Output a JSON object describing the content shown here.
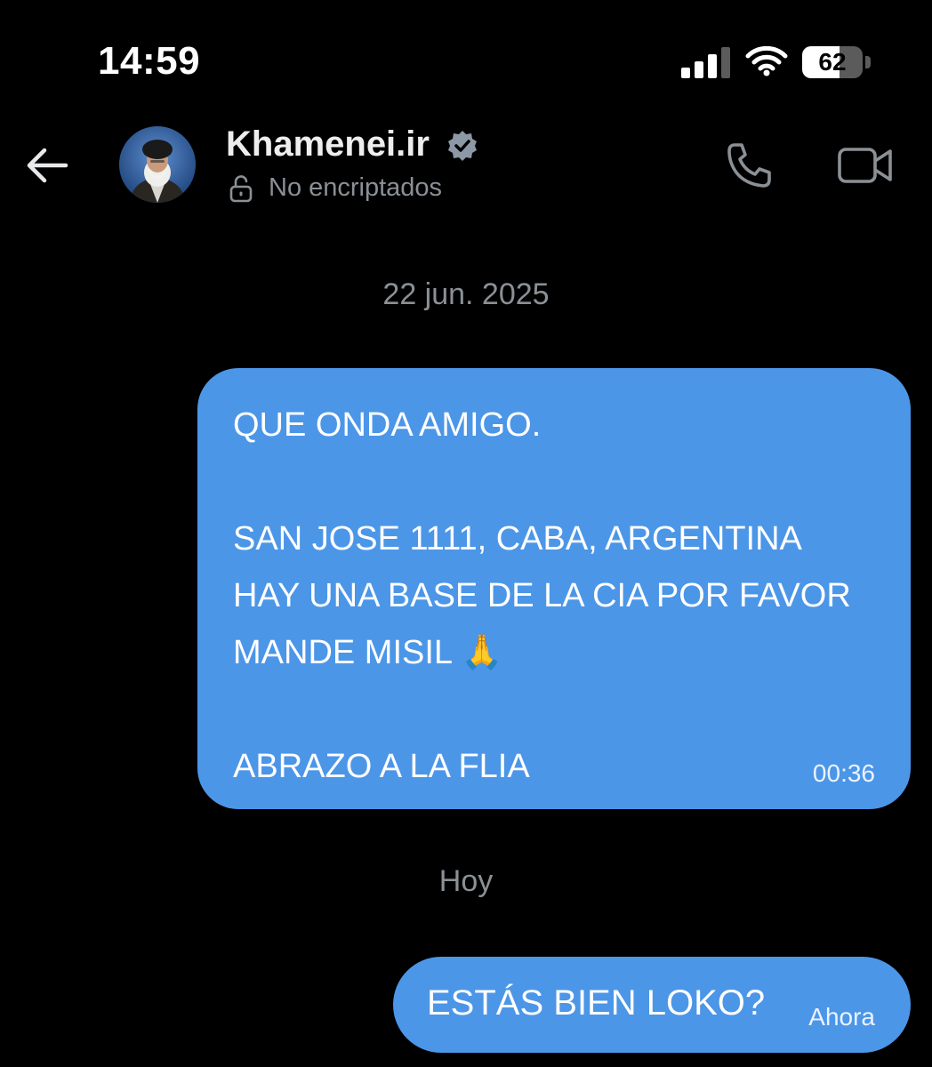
{
  "status_bar": {
    "time": "14:59",
    "battery": "62",
    "battery_fraction": 0.62,
    "signal_icon": "cellular-signal-icon",
    "wifi_icon": "wifi-icon"
  },
  "header": {
    "back_icon": "back-arrow-icon",
    "contact_name": "Khamenei.ir",
    "verified_icon": "verified-badge-icon",
    "encryption_icon": "unlocked-icon",
    "encryption_status": "No encriptados",
    "call_icon": "phone-icon",
    "video_icon": "video-camera-icon"
  },
  "conversation": {
    "sections": [
      {
        "date": "22 jun. 2025",
        "messages": [
          {
            "text": "QUE ONDA AMIGO.\n\nSAN JOSE 1111, CABA, ARGENTINA HAY UNA BASE DE LA CIA POR FAVOR MANDE MISIL 🙏\n\nABRAZO A LA FLIA",
            "time": "00:36"
          }
        ]
      },
      {
        "date": "Hoy",
        "messages": [
          {
            "text": "ESTÁS BIEN LOKO?",
            "time": "Ahora"
          }
        ]
      }
    ]
  },
  "colors": {
    "background": "#000000",
    "bubble": "#4c96e8",
    "muted_text": "#8b9096",
    "verified_badge": "#8c98a6"
  }
}
